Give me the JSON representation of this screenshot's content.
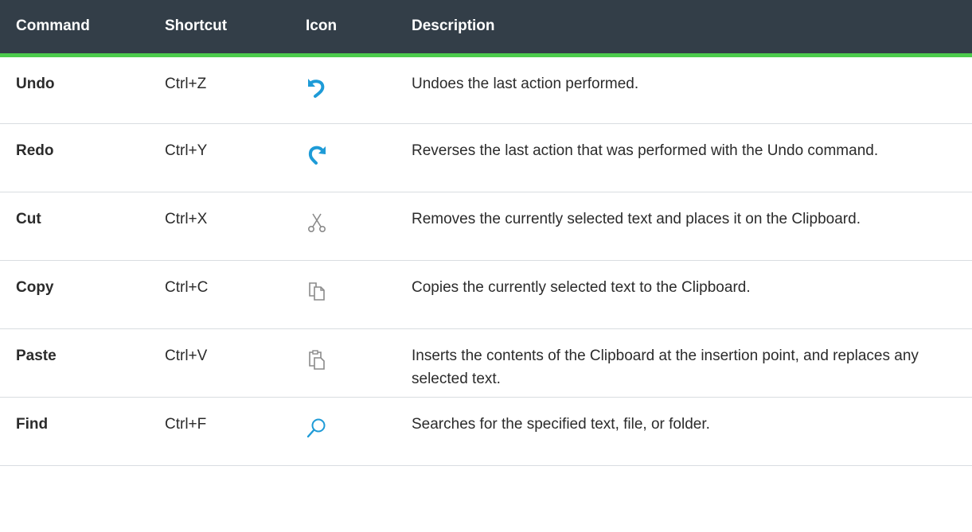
{
  "columns": {
    "command": "Command",
    "shortcut": "Shortcut",
    "icon": "Icon",
    "description": "Description"
  },
  "rows": [
    {
      "command": "Undo",
      "shortcut": "Ctrl+Z",
      "icon": "undo-icon",
      "description": "Undoes the last action performed."
    },
    {
      "command": "Redo",
      "shortcut": "Ctrl+Y",
      "icon": "redo-icon",
      "description": "Reverses the last action that was performed with the Undo command."
    },
    {
      "command": "Cut",
      "shortcut": "Ctrl+X",
      "icon": "scissors-icon",
      "description": "Removes the currently selected text and places it on the Clipboard."
    },
    {
      "command": "Copy",
      "shortcut": "Ctrl+C",
      "icon": "copy-icon",
      "description": "Copies the currently selected text to the Clipboard."
    },
    {
      "command": "Paste",
      "shortcut": "Ctrl+V",
      "icon": "paste-icon",
      "description": "Inserts the contents of the Clipboard at the insertion point, and replaces any selected text."
    },
    {
      "command": "Find",
      "shortcut": "Ctrl+F",
      "icon": "search-icon",
      "description": "Searches for the specified text, file, or folder."
    }
  ],
  "colors": {
    "header_bg": "#333e48",
    "header_text": "#ffffff",
    "header_accent": "#4ccb4c",
    "icon_blue": "#1e9bd7",
    "icon_gray": "#8a8a8a"
  }
}
